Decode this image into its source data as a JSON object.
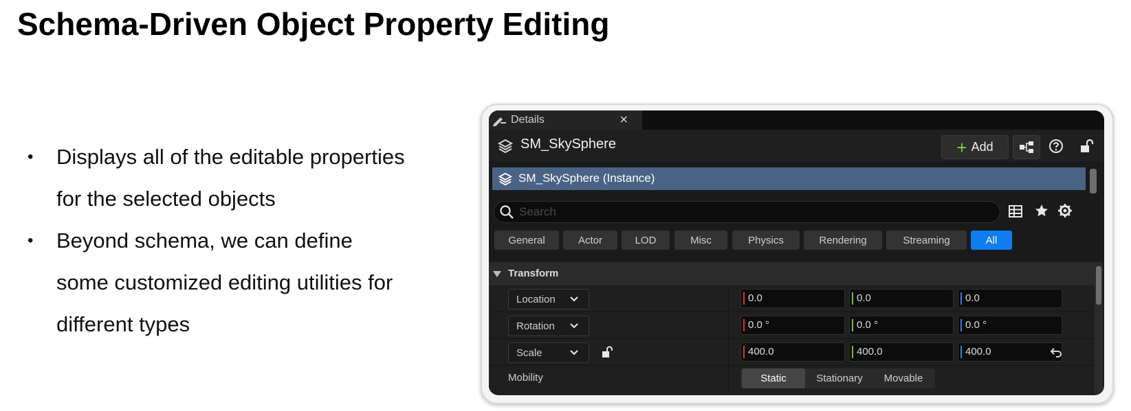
{
  "slide": {
    "title": "Schema-Driven Object Property Editing",
    "bullets": [
      {
        "lines": [
          "Displays all of the editable properties",
          "for the selected objects"
        ]
      },
      {
        "lines": [
          "Beyond schema, we can define",
          "some customized editing utilities for",
          "different types"
        ]
      }
    ]
  },
  "editor": {
    "tab": {
      "label": "Details",
      "close": "×"
    },
    "header": {
      "object_name": "SM_SkySphere",
      "add_label": "Add"
    },
    "component": {
      "label": "SM_SkySphere (Instance)"
    },
    "search": {
      "placeholder": "Search"
    },
    "filters": [
      "General",
      "Actor",
      "LOD",
      "Misc",
      "Physics",
      "Rendering",
      "Streaming",
      "All"
    ],
    "active_filter": "All",
    "section": {
      "label": "Transform"
    },
    "transform": {
      "location": {
        "label": "Location",
        "x": "0.0",
        "y": "0.0",
        "z": "0.0"
      },
      "rotation": {
        "label": "Rotation",
        "x": "0.0 °",
        "y": "0.0 °",
        "z": "0.0 °"
      },
      "scale": {
        "label": "Scale",
        "x": "400.0",
        "y": "400.0",
        "z": "400.0"
      }
    },
    "mobility": {
      "label": "Mobility",
      "options": [
        "Static",
        "Stationary",
        "Movable"
      ],
      "selected": "Static"
    },
    "axis_colors": {
      "x": "#e2352b",
      "y": "#6bc233",
      "z": "#2f7fe0"
    },
    "accent_color": "#0f7cf0"
  }
}
